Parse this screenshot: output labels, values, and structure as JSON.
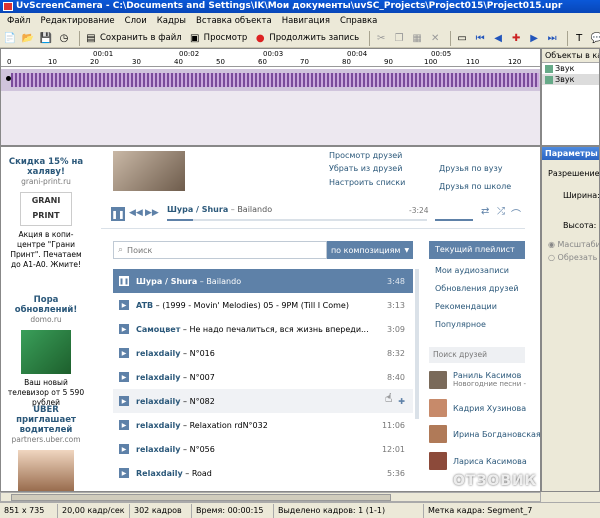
{
  "window": {
    "title": "UvScreenCamera - C:\\Documents and Settings\\IK\\Мои документы\\uvSC_Projects\\Project015\\Project015.upr"
  },
  "menu": [
    "Файл",
    "Редактирование",
    "Слои",
    "Кадры",
    "Вставка объекта",
    "Навигация",
    "Справка"
  ],
  "toolbar": {
    "save_label": "Сохранить в файл",
    "preview_label": "Просмотр",
    "continue_label": "Продолжить запись"
  },
  "timeline": {
    "time_labels": [
      "00:01",
      "00:02",
      "00:03",
      "00:04",
      "00:05"
    ],
    "frame_labels": [
      "0",
      "10",
      "20",
      "30",
      "40",
      "50",
      "60",
      "70",
      "80",
      "90",
      "100",
      "110",
      "120"
    ]
  },
  "objects_panel": {
    "title": "Объекты в кадре",
    "items": [
      "Звук",
      "Звук"
    ]
  },
  "params_panel": {
    "title": "Параметры в",
    "resolution_label": "Разрешение:",
    "width_label": "Ширина:",
    "height_label": "Высота:",
    "scale_label": "Масштабир",
    "crop_label": "Обрезать (к"
  },
  "ads": [
    {
      "title": "Скидка 15% на халяву!",
      "domain": "grani-print.ru",
      "logo": "GRANI PRINT",
      "text": "Акция в копи-центре \"Грани Принт\". Печатаем до А1-А0. Жмите!"
    },
    {
      "title": "Пора обновлений!",
      "domain": "domo.ru",
      "text": "Ваш новый телевизор от 5 590 рублей"
    },
    {
      "title": "UBER приглашает водителей",
      "domain": "partners.uber.com",
      "text": ""
    }
  ],
  "vk_menu": {
    "links_mid": [
      "Просмотр друзей",
      "Убрать из друзей",
      "Настроить списки"
    ],
    "links_right": [
      "Друзья по вузу",
      "Друзья по школе"
    ]
  },
  "player": {
    "now_playing_artist": "Шура / Shura",
    "now_playing_title": "Bailando",
    "time": "-3:24"
  },
  "search": {
    "placeholder": "Поиск",
    "filter_label": "по композициям"
  },
  "tracks": [
    {
      "artist": "Шура / Shura",
      "title": "Bailando",
      "duration": "3:48",
      "active": true
    },
    {
      "artist": "ATB",
      "title": "(1999 - Movin' Melodies) 05 - 9PM (Till I Come)",
      "duration": "3:13"
    },
    {
      "artist": "Самоцвет",
      "title": "Не надо печалиться, вся жизнь впереди...",
      "duration": "3:09"
    },
    {
      "artist": "relaxdaily",
      "title": "N°016",
      "duration": "8:32"
    },
    {
      "artist": "relaxdaily",
      "title": "N°007",
      "duration": "8:40"
    },
    {
      "artist": "relaxdaily",
      "title": "N°082",
      "duration": ""
    },
    {
      "artist": "relaxdaily",
      "title": "Relaxation rdN°032",
      "duration": "11:06"
    },
    {
      "artist": "relaxdaily",
      "title": "N°056",
      "duration": "12:01"
    },
    {
      "artist": "Relaxdaily",
      "title": "Road",
      "duration": "5:36"
    }
  ],
  "right_menu": [
    "Текущий плейлист",
    "Мои аудиозаписи",
    "Обновления друзей",
    "Рекомендации",
    "Популярное"
  ],
  "friends_search": "Поиск друзей",
  "friends": [
    {
      "name": "Раниль Касимов",
      "sub": "Новогодние песни -"
    },
    {
      "name": "Кадрия Хузинова",
      "sub": ""
    },
    {
      "name": "Ирина Богдановская",
      "sub": ""
    },
    {
      "name": "Лариса Касимова",
      "sub": ""
    }
  ],
  "status": {
    "resolution": "851 x 735",
    "fps": "20,00 кадр/сек",
    "frames": "302 кадров",
    "time": "Время: 00:00:15",
    "selected": "Выделено кадров: 1 (1-1)",
    "segment": "Метка кадра: Segment_7"
  },
  "watermark": "ОТЗОВИК"
}
